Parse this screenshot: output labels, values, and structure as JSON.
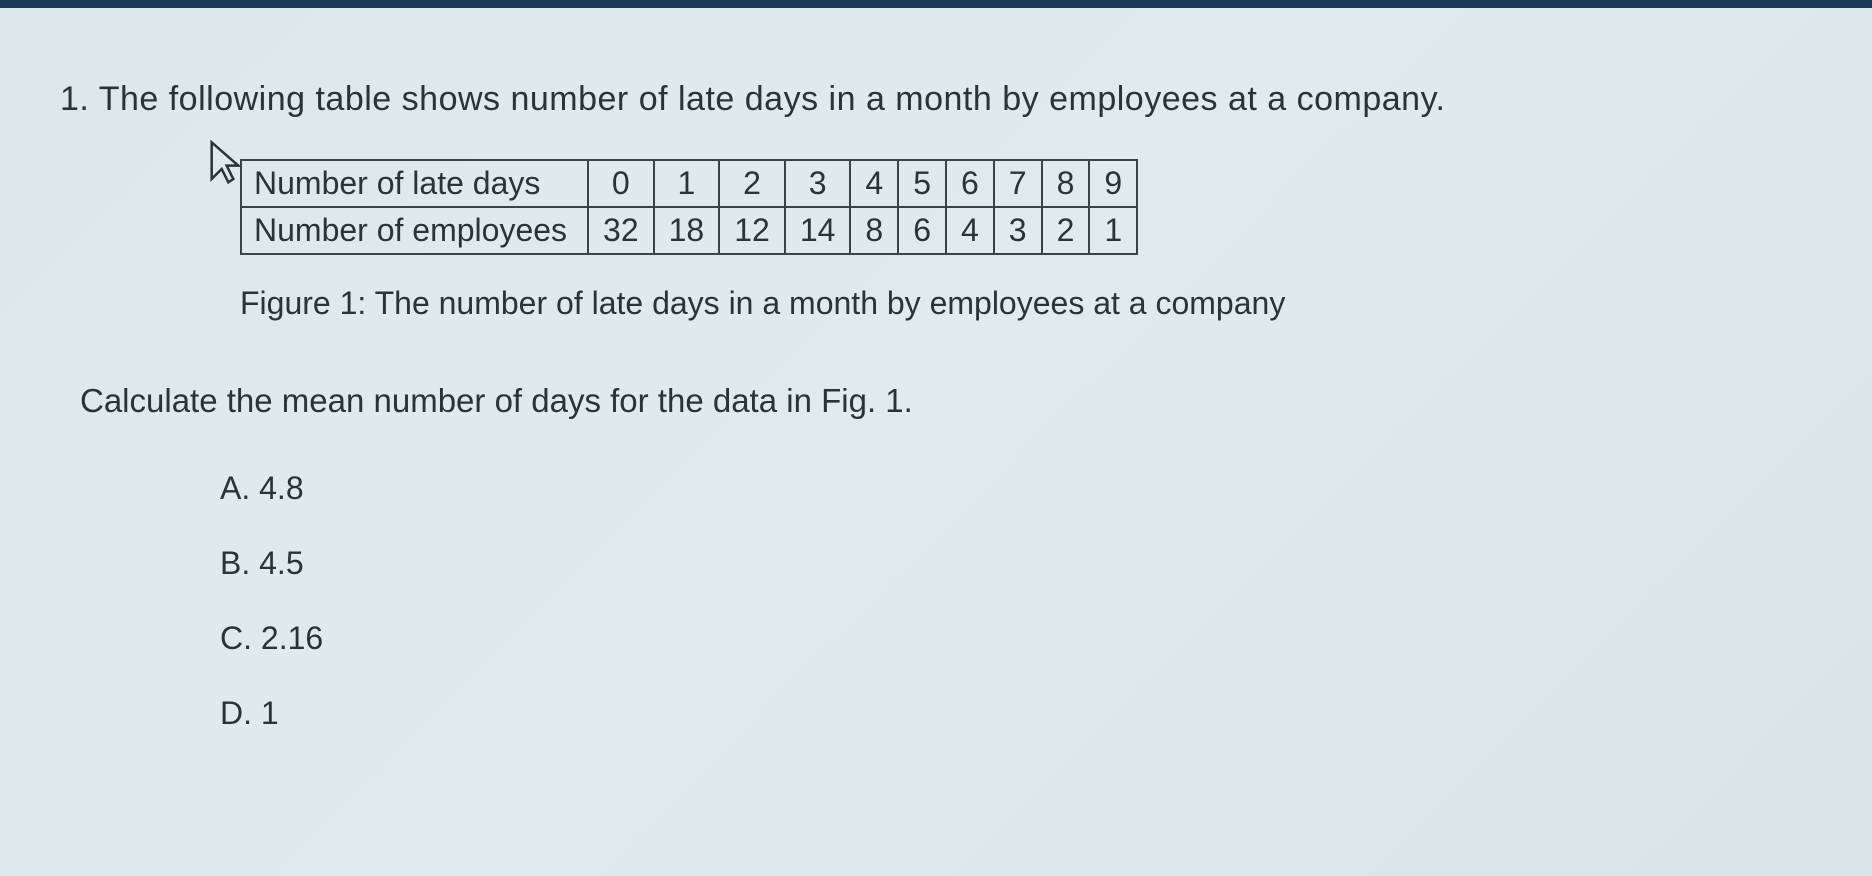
{
  "question": {
    "number": "1.",
    "text": "The following table shows number of late days in a month by employees at a company."
  },
  "table": {
    "row1_label": "Number of late days",
    "row2_label": "Number of employees",
    "late_days": [
      "0",
      "1",
      "2",
      "3",
      "4",
      "5",
      "6",
      "7",
      "8",
      "9"
    ],
    "employees": [
      "32",
      "18",
      "12",
      "14",
      "8",
      "6",
      "4",
      "3",
      "2",
      "1"
    ]
  },
  "figure_caption": "Figure 1: The number of late days in a month by employees at a company",
  "instruction": "Calculate the mean number of days for the data in Fig. 1.",
  "options": {
    "a": "A. 4.8",
    "b": "B. 4.5",
    "c": "C. 2.16",
    "d": "D. 1"
  },
  "chart_data": {
    "type": "table",
    "title": "The number of late days in a month by employees at a company",
    "categories": [
      0,
      1,
      2,
      3,
      4,
      5,
      6,
      7,
      8,
      9
    ],
    "series": [
      {
        "name": "Number of late days",
        "values": [
          0,
          1,
          2,
          3,
          4,
          5,
          6,
          7,
          8,
          9
        ]
      },
      {
        "name": "Number of employees",
        "values": [
          32,
          18,
          12,
          14,
          8,
          6,
          4,
          3,
          2,
          1
        ]
      }
    ]
  }
}
